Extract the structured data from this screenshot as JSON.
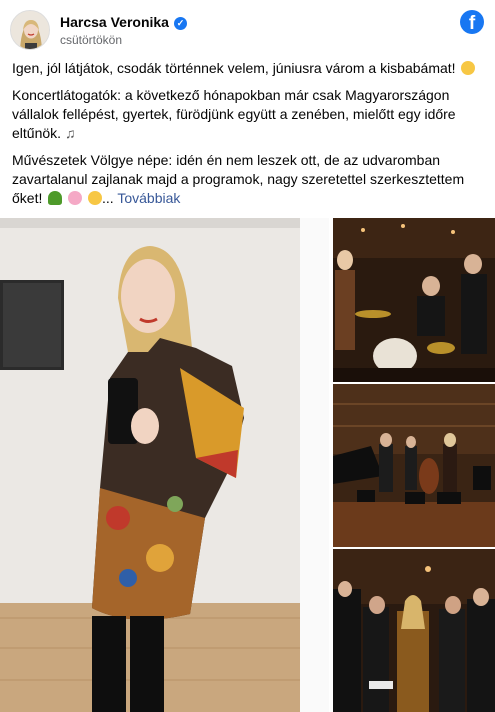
{
  "post": {
    "author": "Harcsa Veronika",
    "timestamp": "csütörtökön",
    "verified_icon": "check-badge-icon",
    "facebook_icon": "facebook-logo-icon",
    "paragraph_1": "Igen, jól látjátok, csodák történnek velem, júniusra várom a kisbabámat!",
    "paragraph_2": "Koncertlátogatók: a következő hónapokban már csak Magyarországon vállalok fellépést, gyertek, fürödjünk együtt a zenében, mielőtt egy időre eltűnök.",
    "paragraph_3": "Művészetek Völgye népe: idén én nem leszek ott, de az udvaromban zavartalanul zajlanak majd a programok, nagy szeretettel szerkesztettem őket!",
    "ellipsis": "...",
    "see_more": "Továbbiak",
    "emojis": {
      "p1": "smiling-face-with-hearts",
      "p2": "musical-notes",
      "p3": [
        "deciduous-tree",
        "cherry-blossom",
        "grinning-face"
      ]
    }
  },
  "colors": {
    "facebook_blue": "#1877f2",
    "link": "#385898",
    "text": "#050505",
    "secondary": "#65676b"
  },
  "photos": {
    "main": "selfie-in-mirror-pregnant-woman-patterned-dress",
    "thumbs": [
      "concert-stage-band-with-drums",
      "concert-hall-jazz-quartet",
      "musicians-bowing-on-stage"
    ]
  }
}
